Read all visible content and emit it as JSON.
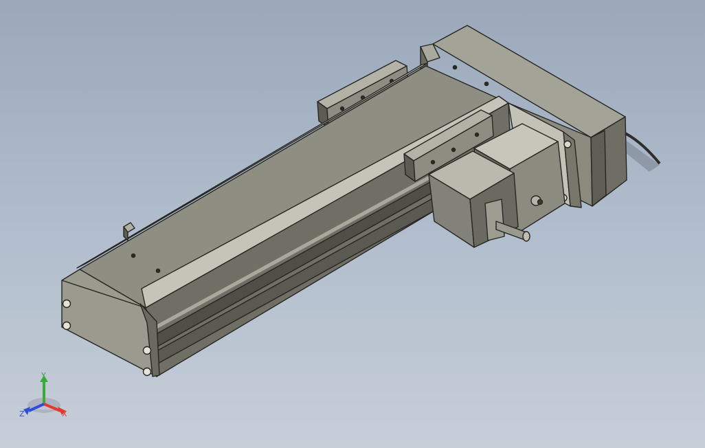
{
  "viewport": {
    "background_top": "#9aa8ba",
    "background_bottom": "#c6ced8"
  },
  "model": {
    "body_color": "#8c8c7f",
    "edge_color": "#262623",
    "highlight_color": "#c9c9bd",
    "shadow_color": "#55554d"
  },
  "triad": {
    "x_label": "X",
    "y_label": "Y",
    "z_label": "Z",
    "x_color": "#e23a2e",
    "y_color": "#3aa83a",
    "z_color": "#2d4fd8"
  }
}
